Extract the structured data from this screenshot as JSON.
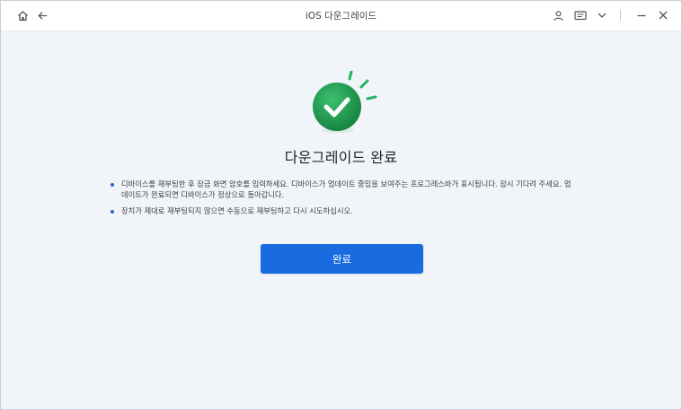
{
  "window": {
    "title": "iOS 다운그레이드"
  },
  "titlebar": {
    "left_icons": [
      "home-icon",
      "back-arrow-icon"
    ],
    "right_icons": [
      "user-icon",
      "feedback-icon",
      "chevron-down-icon",
      "minimize-icon",
      "close-icon"
    ]
  },
  "main": {
    "heading": "다운그레이드 완료",
    "notes": [
      "디바이스를 재부팅한 후 잠금 화면 암호를 입력하세요. 디바이스가 업데이트 중임을 보여주는 프로그레스바가  표시됩니다. 잠시 기다려 주세요. 업데이트가 완료되면 디바이스가 정상으로 돌아갑니다.",
      "장치가 제대로 재부팅되지 않으면 수동으로 재부팅하고 다시 시도하십시오."
    ],
    "done_button": "완료"
  },
  "colors": {
    "accent": "#1a6be0",
    "success": "#1e9a54",
    "background": "#f1f5f9"
  }
}
